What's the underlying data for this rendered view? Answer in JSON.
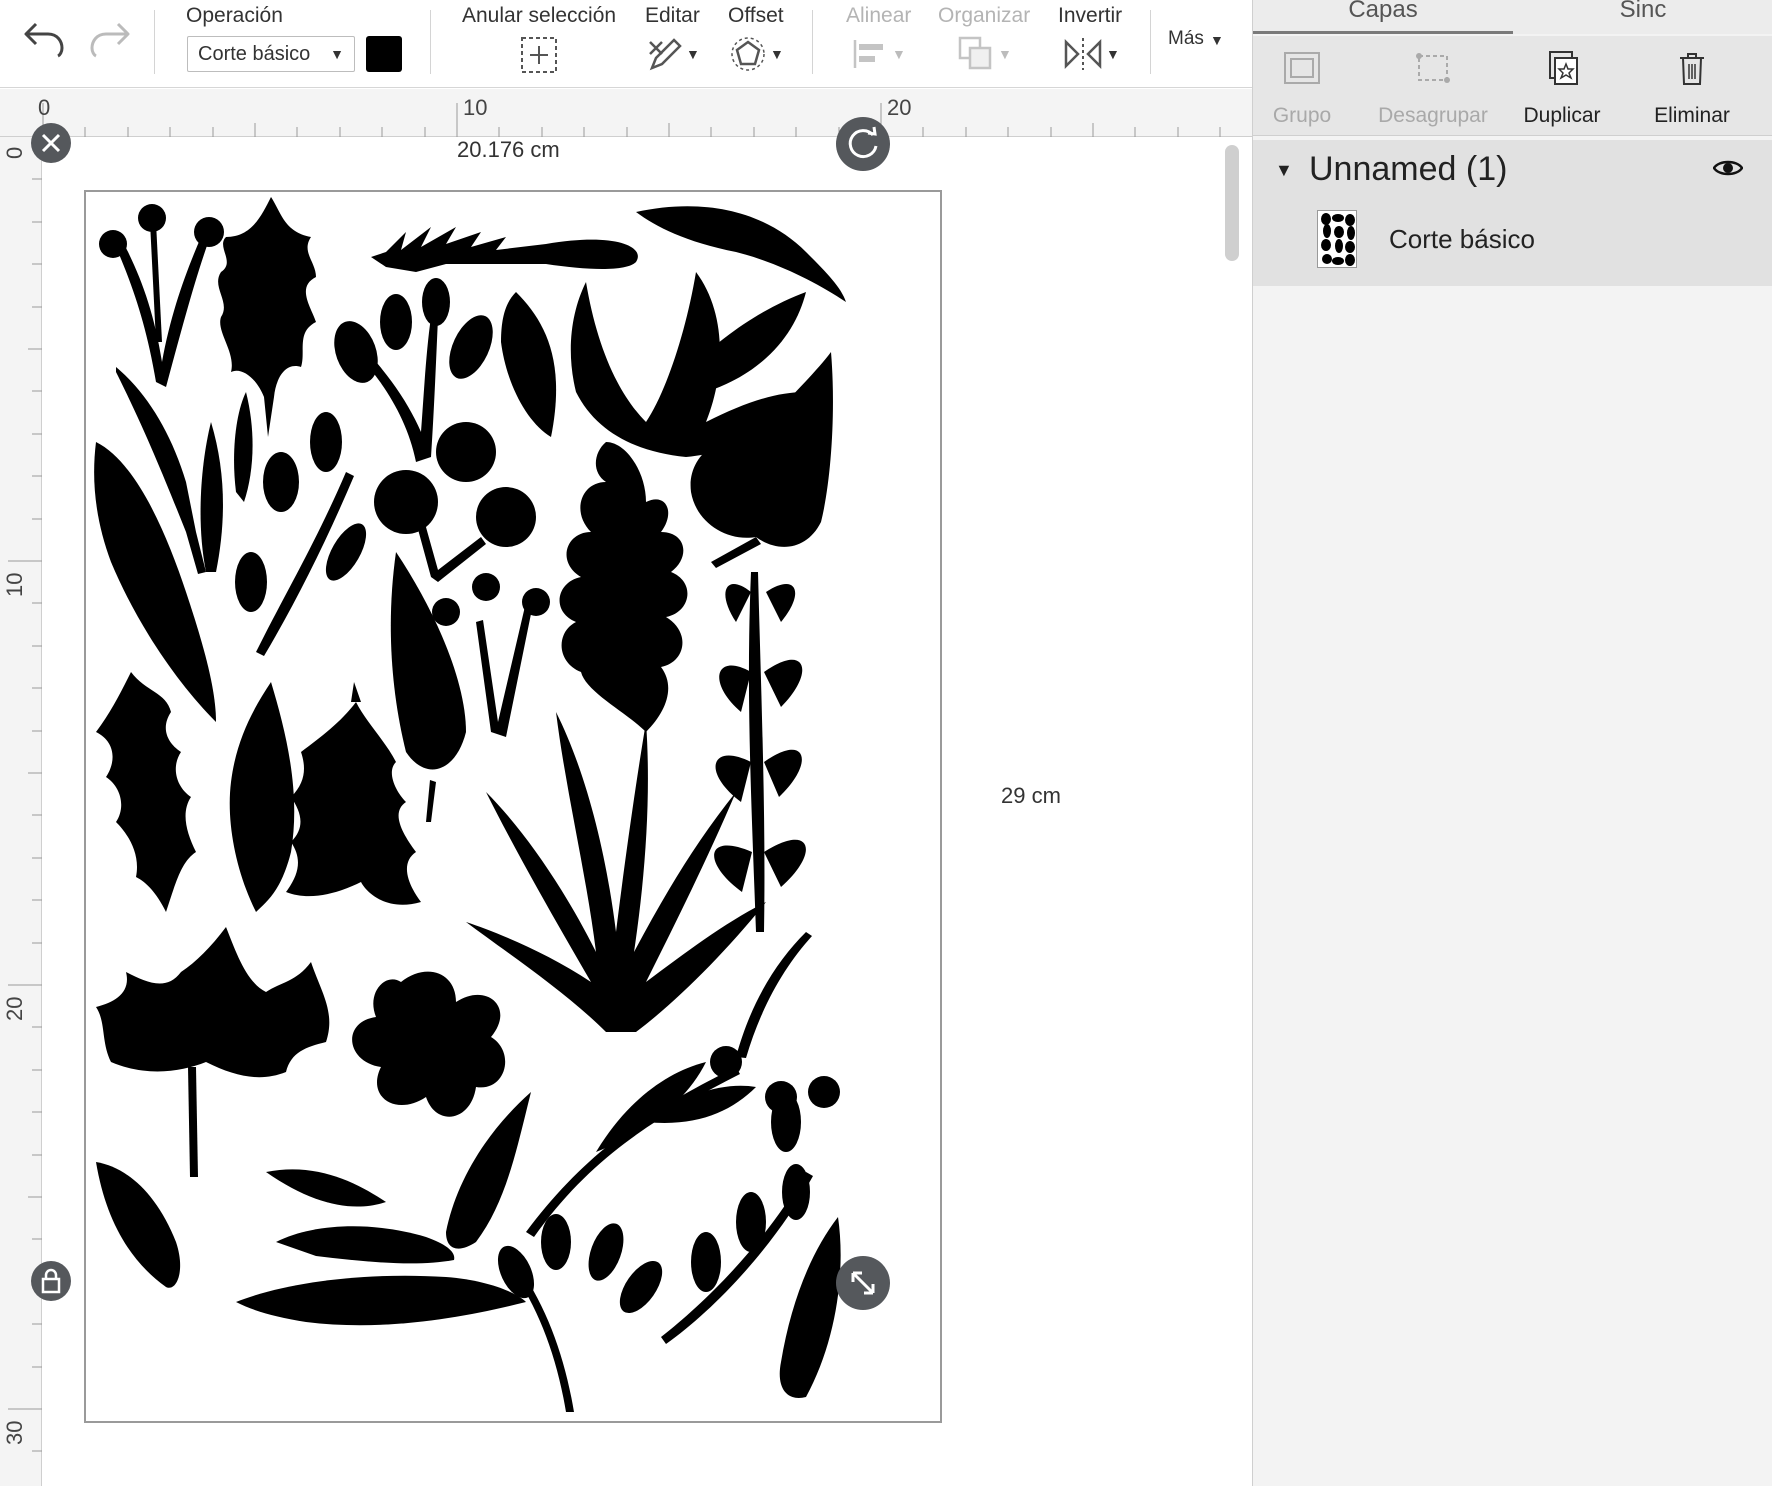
{
  "toolbar": {
    "operation_label": "Operación",
    "operation_value": "Corte básico",
    "deselect_label": "Anular selección",
    "edit_label": "Editar",
    "offset_label": "Offset",
    "align_label": "Alinear",
    "arrange_label": "Organizar",
    "flip_label": "Invertir",
    "more_label": "Más",
    "color": "#000000"
  },
  "ruler": {
    "top_ticks": [
      "0",
      "10",
      "20"
    ],
    "left_ticks": [
      "0",
      "10",
      "20",
      "30"
    ]
  },
  "canvas": {
    "width_label": "20.176 cm",
    "height_label": "29 cm"
  },
  "panel": {
    "tabs": [
      "Capas",
      "Sinc"
    ],
    "actions": {
      "group": "Grupo",
      "ungroup": "Desagrupar",
      "duplicate": "Duplicar",
      "delete": "Eliminar"
    },
    "layer_group_name": "Unnamed (1)",
    "layer_item_name": "Corte básico"
  }
}
